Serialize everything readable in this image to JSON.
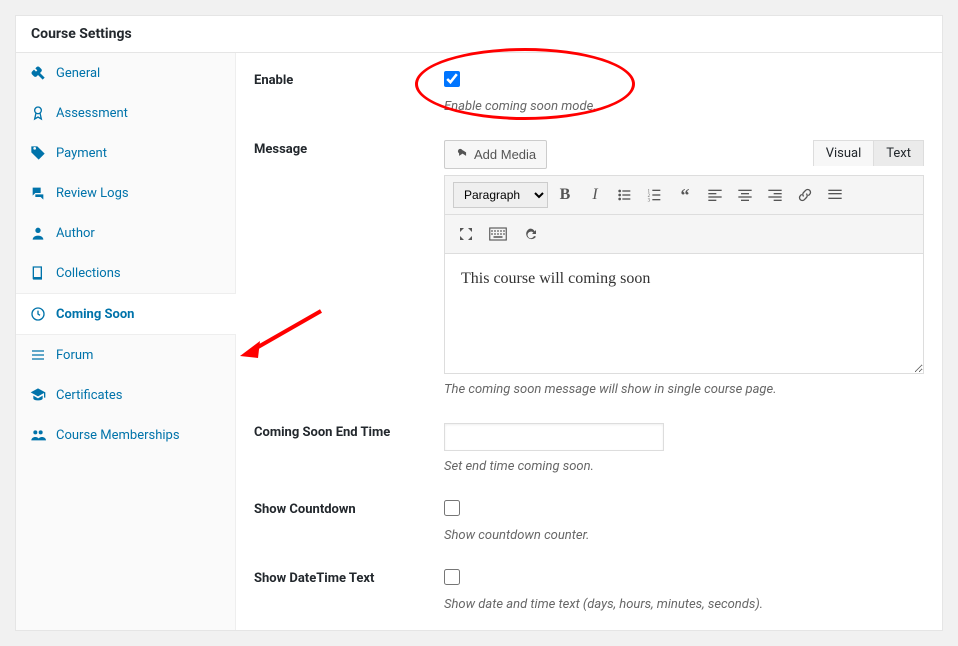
{
  "header": {
    "title": "Course Settings"
  },
  "sidebar": {
    "items": [
      {
        "label": "General",
        "icon": "wrench"
      },
      {
        "label": "Assessment",
        "icon": "ribbon"
      },
      {
        "label": "Payment",
        "icon": "tag"
      },
      {
        "label": "Review Logs",
        "icon": "comments"
      },
      {
        "label": "Author",
        "icon": "user"
      },
      {
        "label": "Collections",
        "icon": "book"
      },
      {
        "label": "Coming Soon",
        "icon": "clock"
      },
      {
        "label": "Forum",
        "icon": "list"
      },
      {
        "label": "Certificates",
        "icon": "cap"
      },
      {
        "label": "Course Memberships",
        "icon": "group"
      }
    ],
    "active_index": 6
  },
  "form": {
    "enable": {
      "label": "Enable",
      "desc": "Enable coming soon mode.",
      "checked": true
    },
    "message": {
      "label": "Message",
      "add_media": "Add Media",
      "tabs": {
        "visual": "Visual",
        "text": "Text"
      },
      "format_dropdown": "Paragraph",
      "content": "This course will coming soon",
      "desc": "The coming soon message will show in single course page."
    },
    "end_time": {
      "label": "Coming Soon End Time",
      "value": "",
      "desc": "Set end time coming soon."
    },
    "show_countdown": {
      "label": "Show Countdown",
      "checked": false,
      "desc": "Show countdown counter."
    },
    "show_datetime": {
      "label": "Show DateTime Text",
      "checked": false,
      "desc": "Show date and time text (days, hours, minutes, seconds)."
    }
  }
}
